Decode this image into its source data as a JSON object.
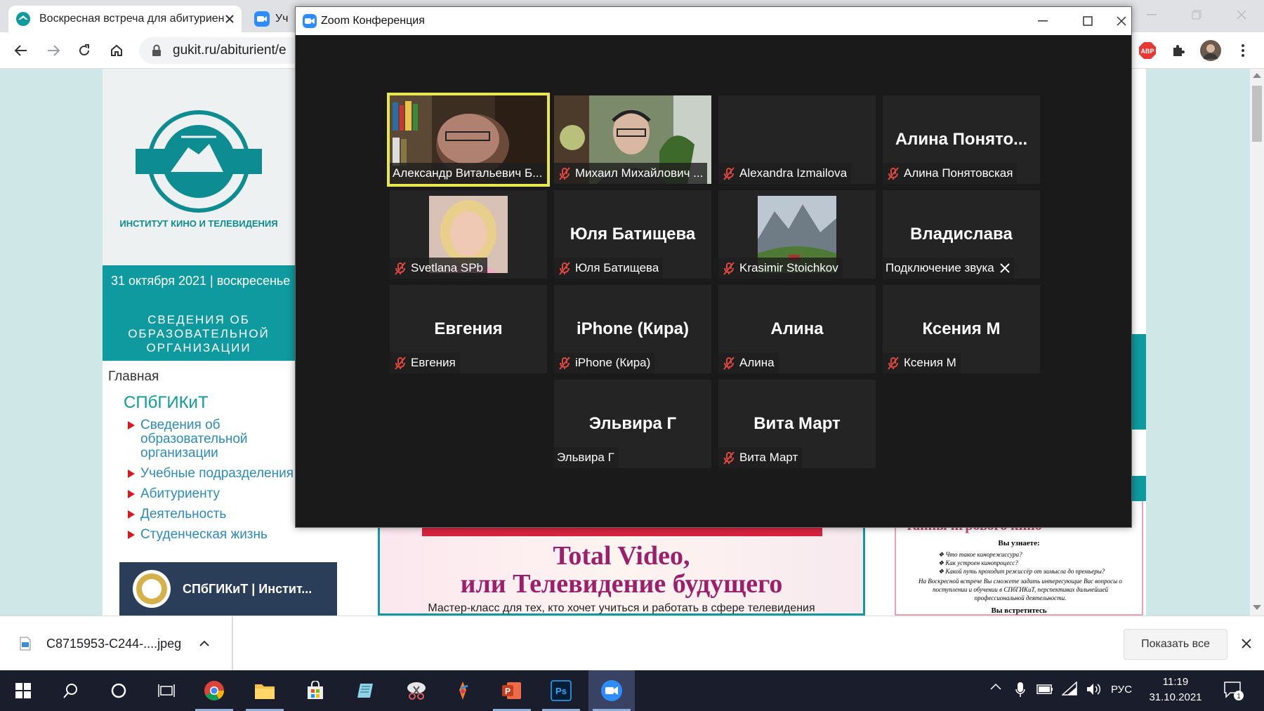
{
  "browser": {
    "tabs": [
      {
        "title": "Воскресная встреча для абитуриентов"
      },
      {
        "title": "Уч"
      }
    ],
    "url": "gukit.ru/abiturient/e",
    "extensions": {
      "adblock_label": "ABP"
    }
  },
  "site": {
    "logo_label": "ИНСТИТУТ КИНО И ТЕЛЕВИДЕНИЯ",
    "date_text": "31 октября 2021 | воскресенье",
    "info_block": "СВЕДЕНИЯ ОБ ОБРАЗОВАТЕЛЬНОЙ ОРГАНИЗАЦИИ",
    "home_link": "Главная",
    "univ_title": "СПбГИКиТ",
    "nav": [
      "Сведения об образовательной организации",
      "Учебные подразделения",
      "Абитуриенту",
      "Деятельность",
      "Студенческая жизнь"
    ],
    "banner_text": "СПбГИКиТ | Инстит...",
    "poster": {
      "line1": "Total Video,",
      "line2": "или Телевидение будущего",
      "line3": "Мастер-класс для тех, кто хочет учиться и работать в сфере телевидения"
    },
    "flyer": {
      "heading": "тайны игрового кино",
      "learn": "Вы узнаете:",
      "items": [
        "Что такое кинорежиссура?",
        "Как устроен кинопроцесс?",
        "Какой путь проходит режиссёр от замысла до премьеры?"
      ],
      "paragraph": "На Воскресной встрече Вы сможете задать интересующие Вас вопросы о поступлении и обучении в СПбГИКиТ, перспективах дальнейшей профессиональной деятельности.",
      "meet": "Вы встретитесь"
    }
  },
  "zoom": {
    "title": "Zoom Конференция",
    "participants": [
      {
        "label": "Александр Витальевич Б...",
        "display": "",
        "video": "bookshelf",
        "muted": false,
        "active": true
      },
      {
        "label": "Михаил Михайлович ...",
        "display": "",
        "video": "man",
        "muted": true,
        "active": false
      },
      {
        "label": "Alexandra Izmailova",
        "display": "",
        "video": "none",
        "muted": true,
        "active": false
      },
      {
        "label": "Алина Понятовская",
        "display": "Алина  Понято...",
        "video": "none",
        "muted": true,
        "active": false
      },
      {
        "label": "Svetlana SPb",
        "display": "",
        "video": "avatar-woman",
        "muted": true,
        "active": false
      },
      {
        "label": "Юля Батищева",
        "display": "Юля Батищева",
        "video": "none",
        "muted": true,
        "active": false
      },
      {
        "label": "Krasimir Stoichkov",
        "display": "",
        "video": "avatar-mountains",
        "muted": true,
        "active": false
      },
      {
        "label": "Подключение звука",
        "display": "Владислава",
        "video": "none",
        "muted": false,
        "connecting": true,
        "active": false
      },
      {
        "label": "Евгения",
        "display": "Евгения",
        "video": "none",
        "muted": true,
        "active": false
      },
      {
        "label": "iPhone (Кира)",
        "display": "iPhone (Кира)",
        "video": "none",
        "muted": true,
        "active": false
      },
      {
        "label": "Алина",
        "display": "Алина",
        "video": "none",
        "muted": true,
        "active": false
      },
      {
        "label": "Ксения М",
        "display": "Ксения М",
        "video": "none",
        "muted": true,
        "active": false
      },
      {
        "label": "Эльвира Г",
        "display": "Эльвира Г",
        "video": "none",
        "muted": false,
        "active": false
      },
      {
        "label": "Вита Март",
        "display": "Вита Март",
        "video": "none",
        "muted": true,
        "active": false
      }
    ],
    "colors": {
      "active_border": "#e6e84e",
      "mute": "#e0473f",
      "tile_bg": "#242424"
    }
  },
  "downloads": {
    "file_name": "C8715953-C244-....jpeg",
    "show_all_label": "Показать все"
  },
  "taskbar": {
    "lang": "РУС",
    "time": "11:19",
    "date": "31.10.2021",
    "notification_count": "1"
  }
}
